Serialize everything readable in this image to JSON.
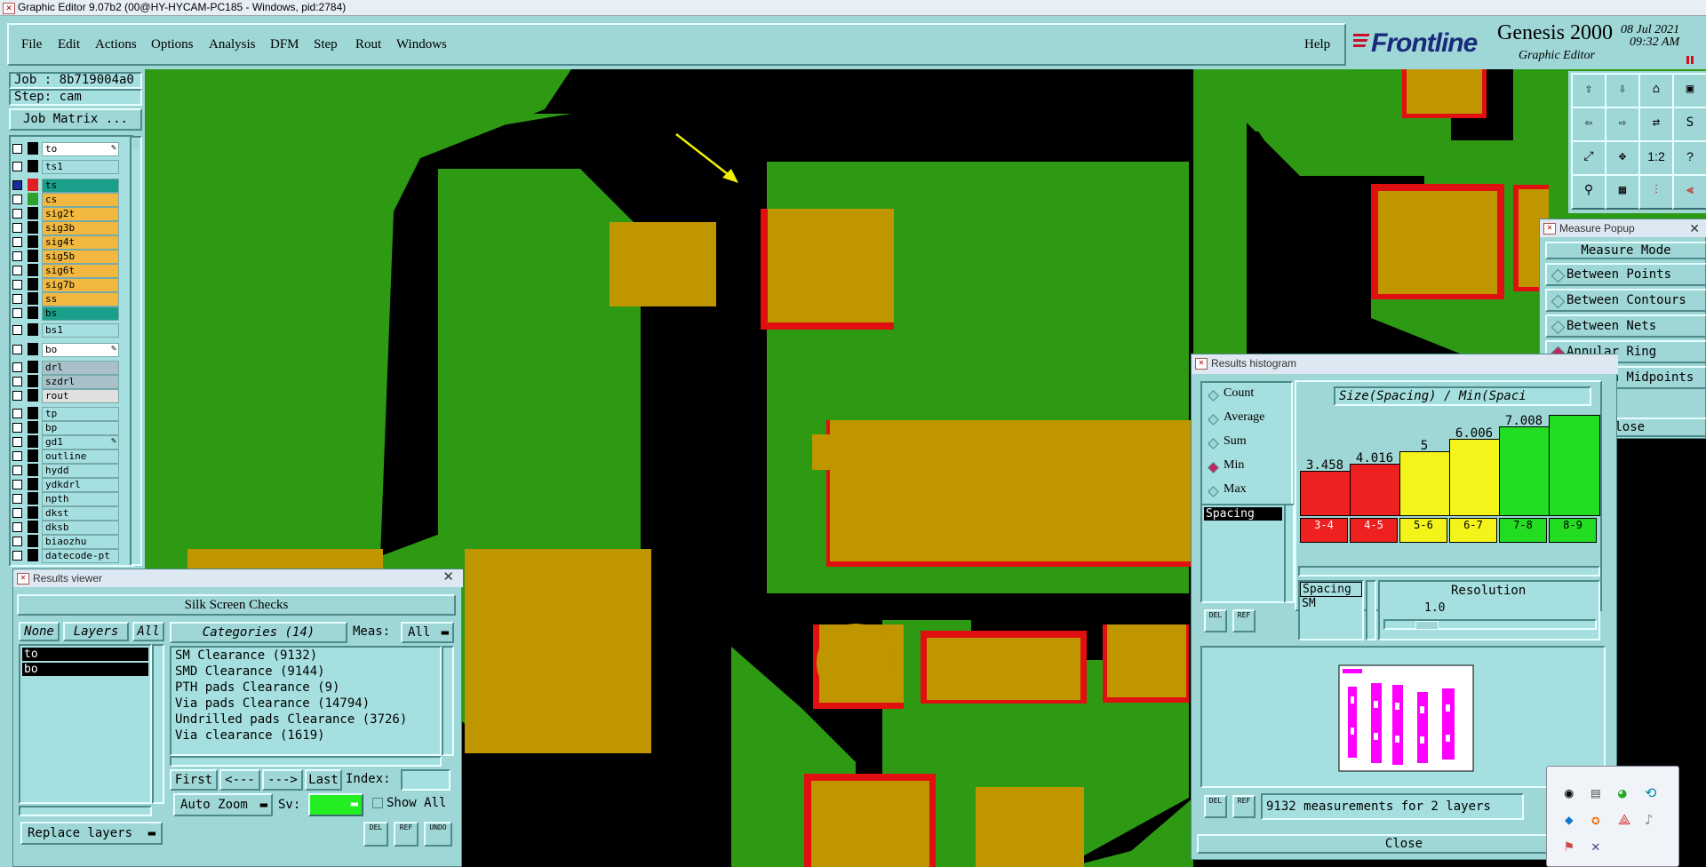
{
  "window": {
    "title": "Graphic Editor 9.07b2 (00@HY-HYCAM-PC185 - Windows, pid:2784)"
  },
  "menu": {
    "items": [
      "File",
      "Edit",
      "Actions",
      "Options",
      "Analysis",
      "DFM",
      "Step",
      "Rout",
      "Windows"
    ],
    "help": "Help"
  },
  "brand": {
    "logo": "Frontline",
    "product": "Genesis 2000",
    "subtitle": "Graphic Editor",
    "date": "08 Jul 2021",
    "time": "09:32 AM",
    "accent": "#c8102e"
  },
  "job": {
    "job_label": "Job : 8b719004a0",
    "step_label": "Step: cam",
    "matrix_button": "Job Matrix ..."
  },
  "layers": [
    {
      "name": "to",
      "color": "#ffffff",
      "swatch": "#000000",
      "mark": "pen"
    },
    {
      "name": "ts1",
      "color": "#a6dfdf",
      "swatch": "#000000"
    },
    {
      "name": "ts",
      "color": "#1aa08a",
      "swatch": "#e02020",
      "mark": "sq"
    },
    {
      "name": "cs",
      "color": "#f2b840",
      "swatch": "#2ea02e"
    },
    {
      "name": "sig2t",
      "color": "#f2b840",
      "swatch": "#000000"
    },
    {
      "name": "sig3b",
      "color": "#f2b840",
      "swatch": "#000000"
    },
    {
      "name": "sig4t",
      "color": "#f2b840",
      "swatch": "#000000"
    },
    {
      "name": "sig5b",
      "color": "#f2b840",
      "swatch": "#000000"
    },
    {
      "name": "sig6t",
      "color": "#f2b840",
      "swatch": "#000000"
    },
    {
      "name": "sig7b",
      "color": "#f2b840",
      "swatch": "#000000"
    },
    {
      "name": "ss",
      "color": "#f2b840",
      "swatch": "#000000"
    },
    {
      "name": "bs",
      "color": "#1aa08a",
      "swatch": "#000000"
    },
    {
      "name": "bs1",
      "color": "#a6dfdf",
      "swatch": "#000000"
    },
    {
      "name": "bo",
      "color": "#ffffff",
      "swatch": "#000000",
      "mark": "pen"
    },
    {
      "name": "drl",
      "color": "#a8c0c8",
      "swatch": "#000000"
    },
    {
      "name": "szdrl",
      "color": "#a8c0c8",
      "swatch": "#000000"
    },
    {
      "name": "rout",
      "color": "#e0e0e0",
      "swatch": "#000000"
    },
    {
      "name": "tp",
      "color": "#a6dfdf",
      "swatch": "#000000"
    },
    {
      "name": "bp",
      "color": "#a6dfdf",
      "swatch": "#000000"
    },
    {
      "name": "gd1",
      "color": "#a6dfdf",
      "swatch": "#000000",
      "mark": "pen"
    },
    {
      "name": "outline",
      "color": "#a6dfdf",
      "swatch": "#000000"
    },
    {
      "name": "hydd",
      "color": "#a6dfdf",
      "swatch": "#000000"
    },
    {
      "name": "ydkdrl",
      "color": "#a6dfdf",
      "swatch": "#000000"
    },
    {
      "name": "npth",
      "color": "#a6dfdf",
      "swatch": "#000000"
    },
    {
      "name": "dkst",
      "color": "#a6dfdf",
      "swatch": "#000000"
    },
    {
      "name": "dksb",
      "color": "#a6dfdf",
      "swatch": "#000000"
    },
    {
      "name": "biaozhu",
      "color": "#a6dfdf",
      "swatch": "#000000"
    },
    {
      "name": "datecode-pt",
      "color": "#a6dfdf",
      "swatch": "#000000"
    }
  ],
  "results_viewer": {
    "title": "Results viewer",
    "header": "Silk Screen Checks",
    "filter": {
      "none": "None",
      "layers": "Layers",
      "all": "All"
    },
    "layer_list": [
      "to",
      "bo"
    ],
    "categories_label": "Categories (14)",
    "meas_label": "Meas:",
    "meas_value": "All",
    "categories": [
      "SM Clearance (9132)",
      "SMD Clearance (9144)",
      "PTH pads Clearance (9)",
      "Via pads Clearance (14794)",
      "Undrilled pads Clearance (3726)",
      "Via clearance (1619)"
    ],
    "nav": {
      "first": "First",
      "prev": "<---",
      "next": "--->",
      "last": "Last",
      "index_label": "Index:",
      "index_value": ""
    },
    "auto_zoom": "Auto Zoom",
    "sv_label": "Sv:",
    "show_all": "Show All",
    "replace_layers": "Replace layers",
    "icons": {
      "del": "DEL",
      "ref": "REF",
      "undo": "UNDO"
    }
  },
  "histogram": {
    "title": "Results histogram",
    "modes": [
      {
        "label": "Count",
        "on": false
      },
      {
        "label": "Average",
        "on": false
      },
      {
        "label": "Sum",
        "on": false
      },
      {
        "label": "Min",
        "on": true
      },
      {
        "label": "Max",
        "on": false
      }
    ],
    "type_list": [
      "Spacing"
    ],
    "chart_title": "Size(Spacing) / Min(Spaci",
    "sub_list": [
      "Spacing",
      "SM"
    ],
    "resolution_label": "Resolution",
    "resolution_value": "1.0",
    "status": "9132 measurements for 2 layers",
    "close": "Close",
    "icons": {
      "del": "DEL",
      "ref": "REF"
    }
  },
  "chart_data": {
    "type": "bar",
    "title": "Size(Spacing) / Min(Spaci",
    "categories": [
      "3-4",
      "4-5",
      "5-6",
      "6-7",
      "7-8",
      "8-9"
    ],
    "values": [
      3.458,
      4.016,
      5,
      6.006,
      7.008,
      null
    ],
    "value_labels": [
      "3.458",
      "4.016",
      "5",
      "6.006",
      "7.008",
      ""
    ],
    "colors": [
      "#ee2020",
      "#ee2020",
      "#f4f41a",
      "#f4f41a",
      "#22dd22",
      "#22dd22"
    ],
    "ylim": [
      0,
      8.5
    ]
  },
  "measure_popup": {
    "title": "Measure Popup",
    "header": "Measure Mode",
    "modes": [
      {
        "label": "Between Points",
        "on": false
      },
      {
        "label": "Between Contours",
        "on": false
      },
      {
        "label": "Between Nets",
        "on": false
      },
      {
        "label": "Annular Ring",
        "on": true
      },
      {
        "label": "Between Midpoints",
        "on": false
      }
    ],
    "close": "Close"
  },
  "toolbar": {
    "ratio_label": "1:2",
    "help_label": "?"
  }
}
